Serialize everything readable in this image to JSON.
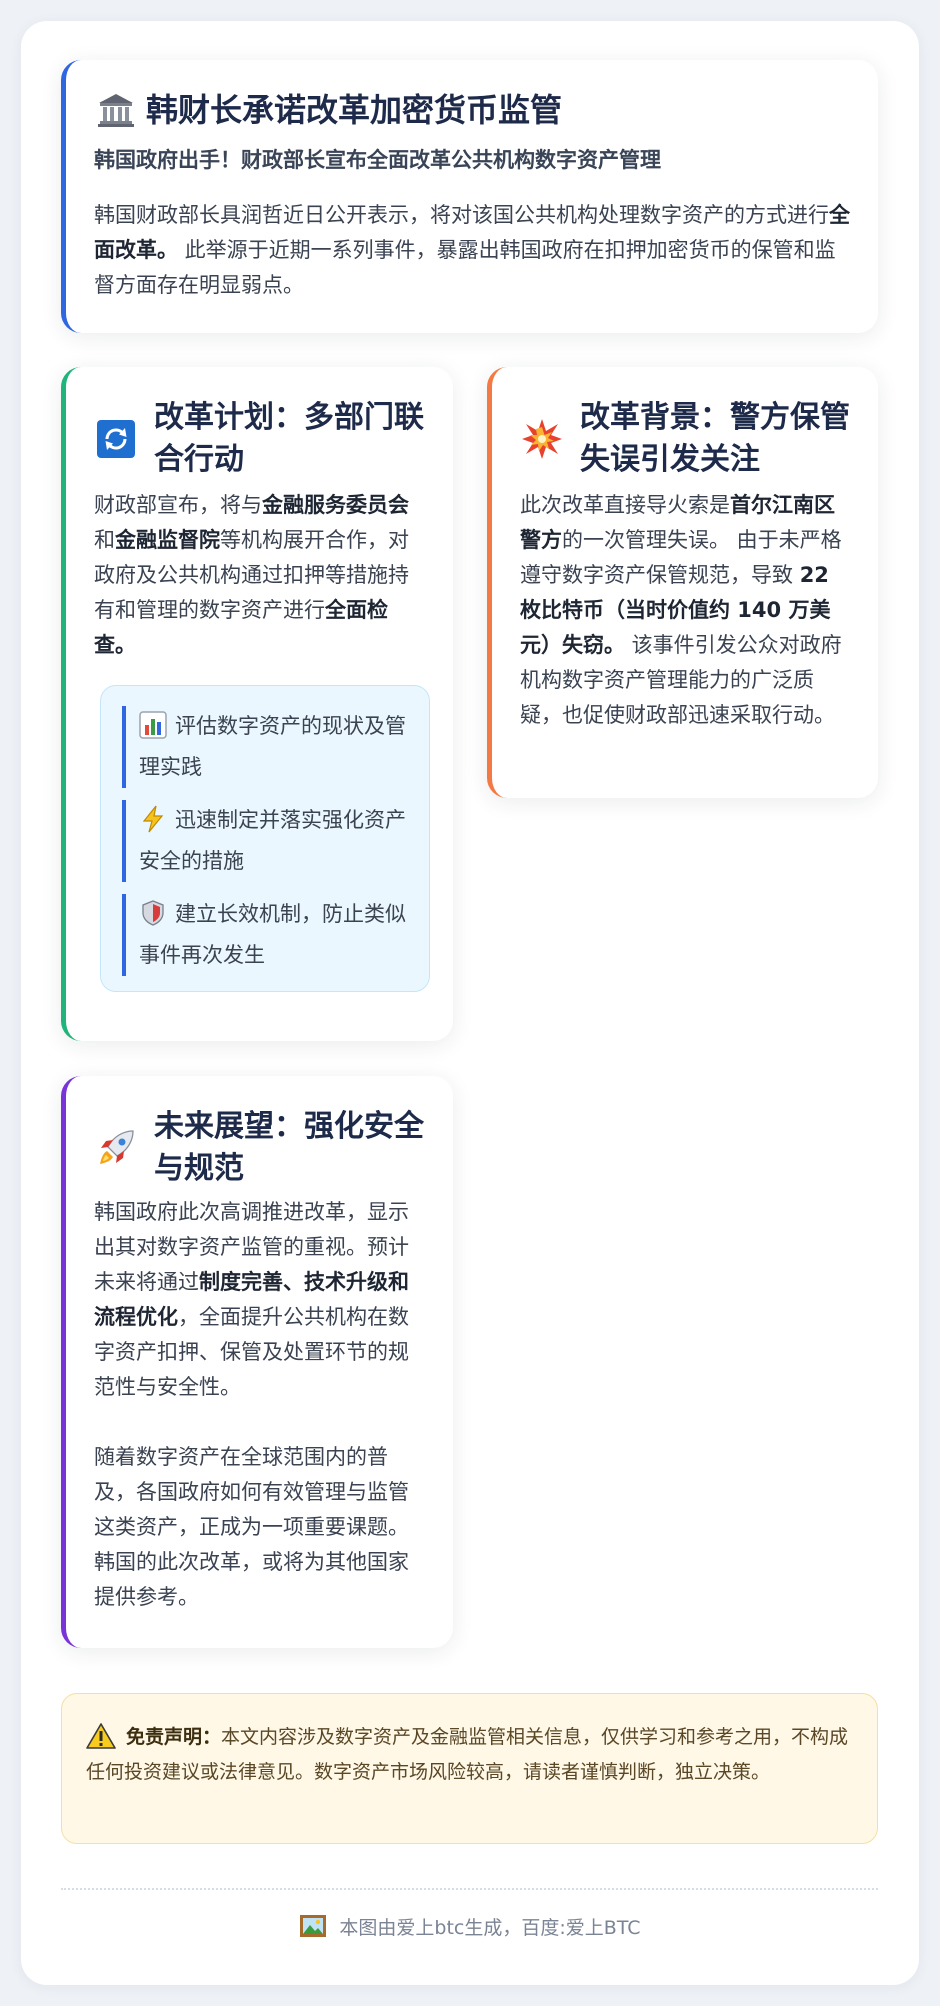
{
  "intro": {
    "icon": "bank-icon",
    "title": "韩财长承诺改革加密货币监管",
    "subtitle": "韩国政府出手！财政部长宣布全面改革公共机构数字资产管理",
    "text_1": "韩国财政部长具润哲近日公开表示，将对该国公共机构处理数字资产的方式进行",
    "text_bold": "全面改革。",
    "text_2": " 此举源于近期一系列事件，暴露出韩国政府在扣押加密货币的保管和监督方面存在明显弱点。"
  },
  "plan": {
    "icon": "refresh-icon",
    "title": "改革计划：多部门联合行动",
    "text_1": "财政部宣布，将与",
    "text_bold_1": "金融服务委员会",
    "text_2": "和",
    "text_bold_2": "金融监督院",
    "text_3": "等机构展开合作，对政府及公共机构通过扣押等措施持有和管理的数字资产进行",
    "text_bold_3": "全面检查。",
    "items": [
      {
        "icon": "bar-chart-icon",
        "text": "评估数字资产的现状及管理实践"
      },
      {
        "icon": "lightning-icon",
        "text": "迅速制定并落实强化资产安全的措施"
      },
      {
        "icon": "shield-icon",
        "text": "建立长效机制，防止类似事件再次发生"
      }
    ]
  },
  "background": {
    "icon": "collision-icon",
    "title": "改革背景：警方保管失误引发关注",
    "text_1": "此次改革直接导火索是",
    "text_bold_1": "首尔江南区警方",
    "text_2": "的一次管理失误。 由于未严格遵守数字资产保管规范，导致 ",
    "text_bold_2": "22 枚比特币（当时价值约 140 万美元）失窃。",
    "text_3": " 该事件引发公众对政府机构数字资产管理能力的广泛质疑，也促使财政部迅速采取行动。"
  },
  "future": {
    "icon": "rocket-icon",
    "title": "未来展望：强化安全与规范",
    "p1_text_1": "韩国政府此次高调推进改革，显示出其对数字资产监管的重视。预计未来将通过",
    "p1_bold": "制度完善、技术升级和流程优化",
    "p1_text_2": "，全面提升公共机构在数字资产扣押、保管及处置环节的规范性与安全性。",
    "p2": "随着数字资产在全球范围内的普及，各国政府如何有效管理与监管这类资产，正成为一项重要课题。韩国的此次改革，或将为其他国家提供参考。"
  },
  "disclaimer": {
    "icon": "warning-icon",
    "label": "免责声明：",
    "text": "本文内容涉及数字资产及金融监管相关信息，仅供学习和参考之用，不构成任何投资建议或法律意见。数字资产市场风险较高，请读者谨慎判断，独立决策。"
  },
  "footer": {
    "icon": "picture-icon",
    "text": "本图由爱上btc生成，百度:爱上BTC"
  },
  "colors": {
    "accent_intro": "#2f66e2",
    "accent_plan": "#1fb47a",
    "accent_background": "#f47a43",
    "accent_future": "#7a33d9",
    "disclaimer_bg": "#fff8e6"
  }
}
